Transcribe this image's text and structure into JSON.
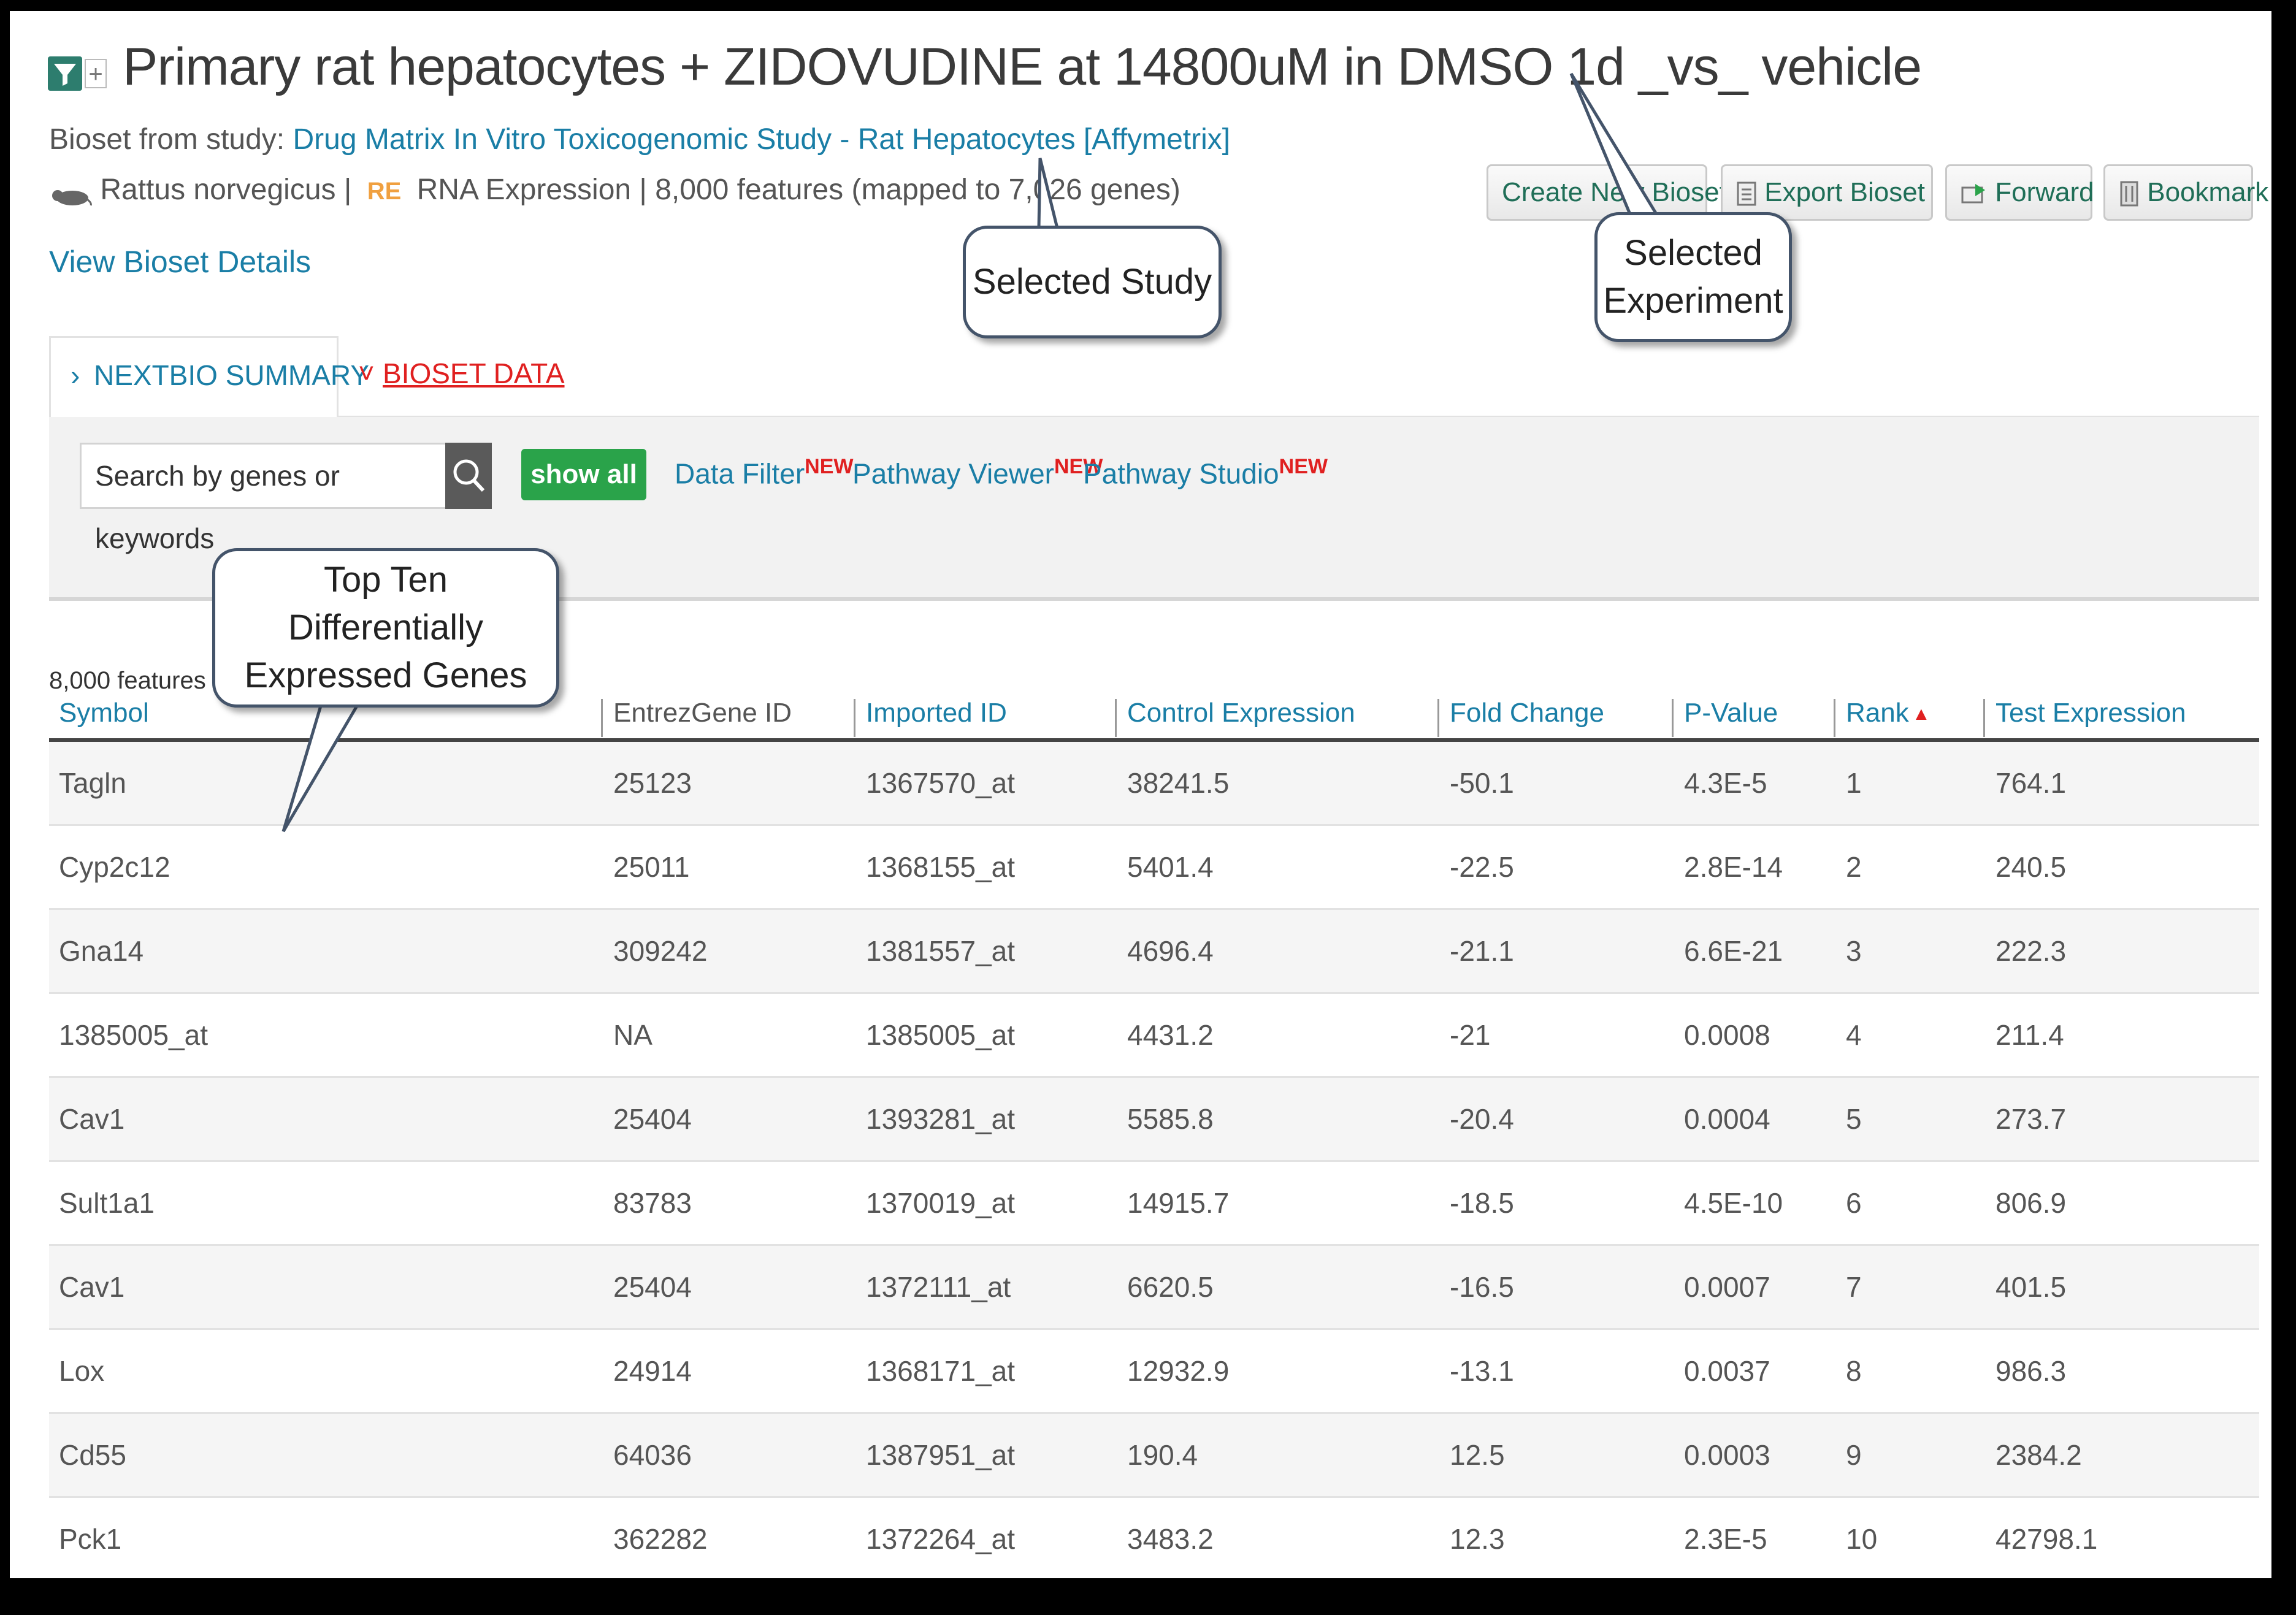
{
  "header": {
    "title": "Primary rat hepatocytes + ZIDOVUDINE at 14800uM in DMSO 1d _vs_ vehicle",
    "bioset_from_label": "Bioset from study:",
    "study_link": "Drug Matrix In Vitro Toxicogenomic Study - Rat Hepatocytes [Affymetrix]",
    "organism": "Rattus norvegicus",
    "re_badge": "RE",
    "info": "RNA Expression | 8,000 features (mapped to 7,026 genes)",
    "view_details": "View Bioset Details"
  },
  "actions": {
    "create_new": "Create New Bioset",
    "export": "Export Bioset",
    "forward": "Forward",
    "bookmark": "Bookmark"
  },
  "tabs": [
    {
      "label": "NEXTBIO SUMMARY",
      "arrow": "›",
      "active": false
    },
    {
      "label": "BIOSET DATA",
      "arrow": "˅",
      "active": true
    }
  ],
  "toolbar": {
    "search_placeholder": "Search by genes or keywords",
    "show_all": "show all",
    "data_filter": "Data Filter",
    "pathway_viewer": "Pathway Viewer",
    "pathway_studio": "Pathway Studio",
    "new_tag": "NEW"
  },
  "table": {
    "feature_count": "8,000 features",
    "columns": [
      "Symbol",
      "EntrezGene ID",
      "Imported ID",
      "Control Expression",
      "Fold Change",
      "P-Value",
      "Rank",
      "Test Expression"
    ],
    "sort_indicator": "▲",
    "rows": [
      [
        "Tagln",
        "25123",
        "1367570_at",
        "38241.5",
        "-50.1",
        "4.3E-5",
        "1",
        "764.1"
      ],
      [
        "Cyp2c12",
        "25011",
        "1368155_at",
        "5401.4",
        "-22.5",
        "2.8E-14",
        "2",
        "240.5"
      ],
      [
        "Gna14",
        "309242",
        "1381557_at",
        "4696.4",
        "-21.1",
        "6.6E-21",
        "3",
        "222.3"
      ],
      [
        "1385005_at",
        "NA",
        "1385005_at",
        "4431.2",
        "-21",
        "0.0008",
        "4",
        "211.4"
      ],
      [
        "Cav1",
        "25404",
        "1393281_at",
        "5585.8",
        "-20.4",
        "0.0004",
        "5",
        "273.7"
      ],
      [
        "Sult1a1",
        "83783",
        "1370019_at",
        "14915.7",
        "-18.5",
        "4.5E-10",
        "6",
        "806.9"
      ],
      [
        "Cav1",
        "25404",
        "1372111_at",
        "6620.5",
        "-16.5",
        "0.0007",
        "7",
        "401.5"
      ],
      [
        "Lox",
        "24914",
        "1368171_at",
        "12932.9",
        "-13.1",
        "0.0037",
        "8",
        "986.3"
      ],
      [
        "Cd55",
        "64036",
        "1387951_at",
        "190.4",
        "12.5",
        "0.0003",
        "9",
        "2384.2"
      ],
      [
        "Pck1",
        "362282",
        "1372264_at",
        "3483.2",
        "12.3",
        "2.3E-5",
        "10",
        "42798.1"
      ]
    ]
  },
  "callouts": {
    "study": "Selected Study",
    "experiment": "Selected Experiment",
    "genes": "Top Ten Differentially Expressed Genes"
  },
  "colors": {
    "link": "#1a7ea6",
    "show_all_bg": "#2aa34a",
    "new_tag": "#e02020",
    "active_tab": "#e02020"
  }
}
